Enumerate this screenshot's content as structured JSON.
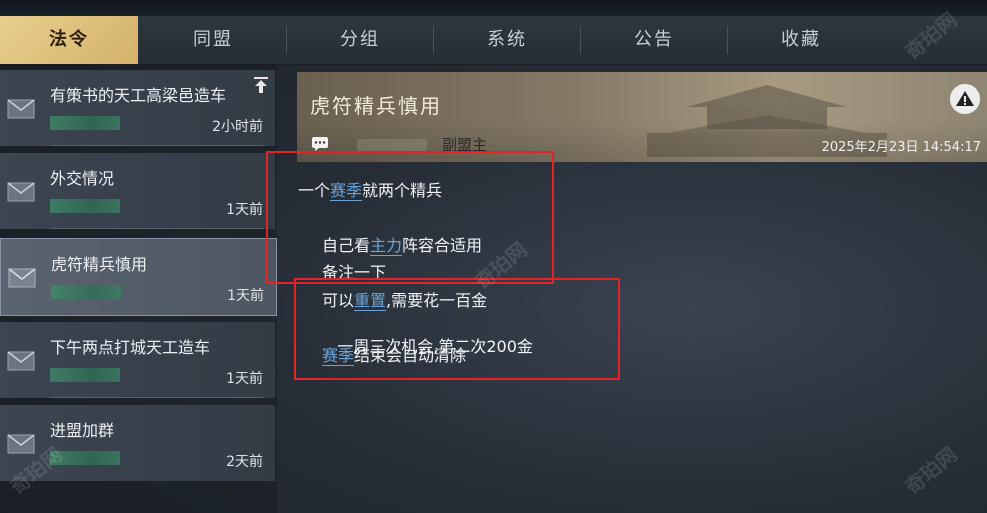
{
  "tabs": {
    "items": [
      {
        "label": "法令"
      },
      {
        "label": "同盟"
      },
      {
        "label": "分组"
      },
      {
        "label": "系统"
      },
      {
        "label": "公告"
      },
      {
        "label": "收藏"
      }
    ],
    "active_index": 0
  },
  "sidebar": {
    "items": [
      {
        "title": "有策书的天工高梁邑造车",
        "time": "2小时前",
        "pinned": true
      },
      {
        "title": "外交情况",
        "time": "1天前"
      },
      {
        "title": "虎符精兵慎用",
        "time": "1天前",
        "selected": true
      },
      {
        "title": "下午两点打城天工造车",
        "time": "1天前"
      },
      {
        "title": "进盟加群",
        "time": "2天前"
      }
    ]
  },
  "message": {
    "title": "虎符精兵慎用",
    "sender_role": "副盟主",
    "timestamp": "2025年2月23日 14:54:17",
    "lines": [
      {
        "pre": "一个",
        "hl": "赛季",
        "post": "就两个精兵"
      },
      {
        "pre": "自己看",
        "hl": "主力",
        "post": "阵容合适用"
      },
      {
        "pre": "备注一下",
        "hl": "",
        "post": ""
      },
      {
        "pre": "可以",
        "hl": "重置",
        "post": ",需要花一百金"
      },
      {
        "pre": " 一周三次机会,第二次200金",
        "hl": "",
        "post": ""
      },
      {
        "pre": "",
        "hl": "赛季",
        "post": "结束会自动清除"
      }
    ]
  },
  "watermark": {
    "text": "奇珀网"
  },
  "colors": {
    "active_tab": "#d4b26a",
    "highlight_text": "#6aa3d8",
    "annotation_box": "#e0242a"
  }
}
